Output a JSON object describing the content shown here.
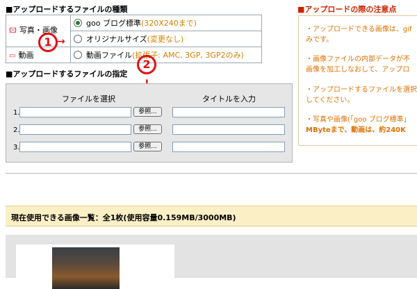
{
  "type_section": {
    "title": "■アップロードするファイルの種類",
    "photo_label": "写真・画像",
    "video_label": "動画",
    "options": [
      {
        "label": "goo ブログ標準",
        "note": "(320X240まで)",
        "selected": true
      },
      {
        "label": "オリジナルサイズ",
        "note": "(変更なし)",
        "selected": false
      },
      {
        "label": "動画ファイル",
        "note": "(拡張子: AMC, 3GP, 3GP2のみ)",
        "selected": false
      }
    ]
  },
  "spec_section": {
    "title": "■アップロードするファイルの指定",
    "file_header": "ファイルを選択",
    "title_header": "タイトルを入力",
    "rows": [
      {
        "num": "1.",
        "browse": "参照..."
      },
      {
        "num": "2.",
        "browse": "参照..."
      },
      {
        "num": "3.",
        "browse": "参照..."
      }
    ]
  },
  "notes": {
    "title": "アップロードの際の注意点",
    "tips": [
      [
        "・アップロードできる画像は、gif",
        "みです。"
      ],
      [
        "・画像ファイルの内部データが不",
        "画像を加工しなおして、アップロ"
      ],
      [
        "・アップロードするファイルを選択",
        "してください。"
      ],
      [
        "・写真や画像(「goo ブログ標準」",
        "MByteまで、動画は、約240K"
      ]
    ]
  },
  "usage_bar": {
    "text": "現在使用できる画像一覧：全1枚(使用容量0.159MB/3000MB)"
  },
  "annotations": {
    "one": "1",
    "two": "2"
  }
}
